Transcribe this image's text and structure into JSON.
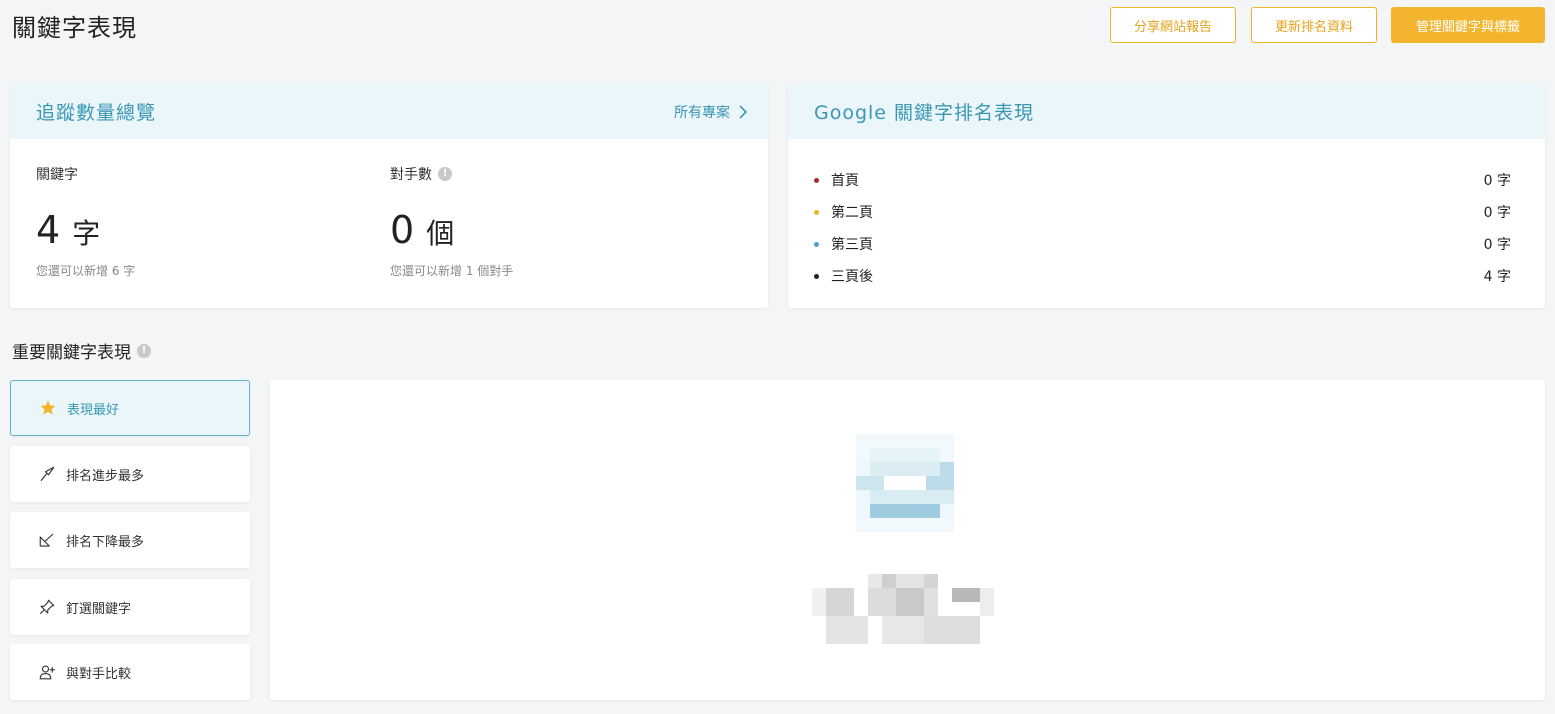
{
  "header": {
    "title": "關鍵字表現",
    "buttons": {
      "share": "分享網站報告",
      "update": "更新排名資料",
      "manage": "管理關鍵字與標籤"
    }
  },
  "tracking": {
    "title": "追蹤數量總覽",
    "link": "所有專案",
    "keywords": {
      "label": "關鍵字",
      "value": "4",
      "unit": "字",
      "sub": "您還可以新增 6 字"
    },
    "competitors": {
      "label": "對手數",
      "value": "0",
      "unit": "個",
      "sub": "您還可以新增 1 個對手"
    }
  },
  "google": {
    "title": "Google 關鍵字排名表現",
    "rows": [
      {
        "label": "首頁",
        "value": "0 字",
        "color": "#b0282c"
      },
      {
        "label": "第二頁",
        "value": "0 字",
        "color": "#f0b429"
      },
      {
        "label": "第三頁",
        "value": "0 字",
        "color": "#4aa3c8"
      },
      {
        "label": "三頁後",
        "value": "4 字",
        "color": "#222222"
      }
    ]
  },
  "important": {
    "title": "重要關鍵字表現",
    "tabs": [
      {
        "label": "表現最好",
        "icon": "star-icon"
      },
      {
        "label": "排名進步最多",
        "icon": "trend-up-icon"
      },
      {
        "label": "排名下降最多",
        "icon": "trend-down-icon"
      },
      {
        "label": "釘選關鍵字",
        "icon": "pin-icon"
      },
      {
        "label": "與對手比較",
        "icon": "add-user-icon"
      }
    ]
  },
  "colors": {
    "accent": "#3b97b4",
    "brand": "#f3b52d",
    "header_bg": "#eaf6fa"
  }
}
